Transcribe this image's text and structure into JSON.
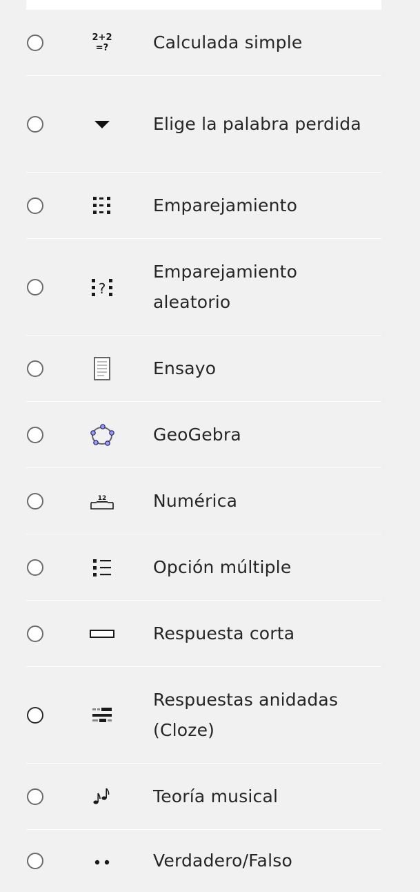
{
  "question_types": [
    {
      "label": "Calculada simple",
      "icon": "calculated-simple-icon"
    },
    {
      "label": "Elige la palabra perdida",
      "icon": "dropdown-triangle-icon"
    },
    {
      "label": "Emparejamiento",
      "icon": "matching-icon"
    },
    {
      "label": "Emparejamiento aleatorio",
      "icon": "random-matching-icon"
    },
    {
      "label": "Ensayo",
      "icon": "essay-icon"
    },
    {
      "label": "GeoGebra",
      "icon": "geogebra-icon"
    },
    {
      "label": "Numérica",
      "icon": "numerical-icon"
    },
    {
      "label": "Opción múltiple",
      "icon": "multiple-choice-icon"
    },
    {
      "label": "Respuesta corta",
      "icon": "short-answer-icon"
    },
    {
      "label": "Respuestas anidadas (Cloze)",
      "icon": "cloze-icon"
    },
    {
      "label": "Teoría musical",
      "icon": "music-notes-icon"
    },
    {
      "label": "Verdadero/Falso",
      "icon": "true-false-icon"
    }
  ],
  "icon_glyphs": {
    "calc_top": "2+2",
    "calc_bottom": "=?",
    "random_q": "?",
    "numeric_value": "12"
  }
}
